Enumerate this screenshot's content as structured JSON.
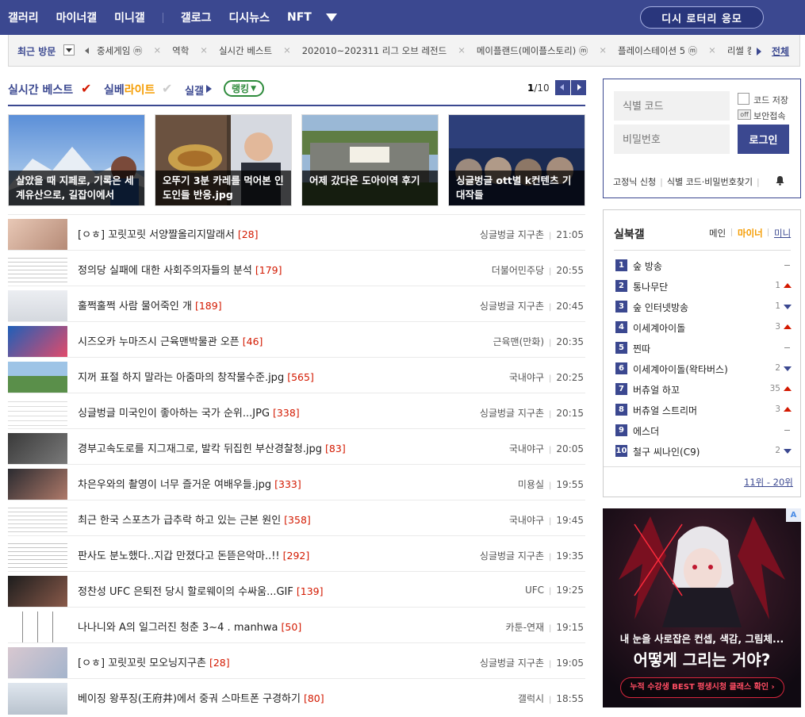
{
  "nav": {
    "items": [
      "갤러리",
      "마이너갤",
      "미니갤",
      "갤로그",
      "디시뉴스",
      "NFT"
    ],
    "lottery_button": "디시 로터리 응모"
  },
  "recent": {
    "label": "최근 방문",
    "items": [
      "중세게임 ⓜ",
      "역학",
      "실시간 베스트",
      "202010~202311 리그 오브 레전드",
      "메이플랜드(메이플스토리) ⓜ",
      "플레이스테이션 5 ⓜ",
      "리썰 컴퍼니"
    ],
    "all_label": "전체"
  },
  "best": {
    "tab_realtime": "실시간 베스트",
    "tab_light_a": "실베",
    "tab_light_b": "라이트",
    "tab_realgal": "실갤",
    "tab_ranking": "랭킹",
    "page_current": "1",
    "page_total": "/10"
  },
  "cards": [
    {
      "caption": "살았을 때 지페로, 기록은 세계유산으로, 길잡이에서"
    },
    {
      "caption": "오뚜기 3분 카레를 먹어본 인도인들 반응.jpg"
    },
    {
      "caption": "어제 갔다온 도아이역 후기"
    },
    {
      "caption": "싱글벙글 ott별 k컨텐츠 기대작들"
    }
  ],
  "posts": [
    {
      "title": "[ㅇㅎ] 꼬릿꼬릿 서양짤올리지말래서",
      "count": "[28]",
      "gallery": "싱글벙글 지구촌",
      "time": "21:05"
    },
    {
      "title": "정의당 실패에 대한 사회주의자들의 분석",
      "count": "[179]",
      "gallery": "더불어민주당",
      "time": "20:55"
    },
    {
      "title": "훌쩍훌쩍 사람 물어죽인 개",
      "count": "[189]",
      "gallery": "싱글벙글 지구촌",
      "time": "20:45"
    },
    {
      "title": "시즈오카 누마즈시 근육맨박물관 오픈",
      "count": "[46]",
      "gallery": "근육맨(만화)",
      "time": "20:35"
    },
    {
      "title": "지꺼 표절 하지 말라는 아줌마의 창작물수준.jpg",
      "count": "[565]",
      "gallery": "국내야구",
      "time": "20:25"
    },
    {
      "title": "싱글벙글 미국인이 좋아하는 국가 순위...JPG",
      "count": "[338]",
      "gallery": "싱글벙글 지구촌",
      "time": "20:15"
    },
    {
      "title": "경부고속도로를 지그재그로, 발칵 뒤집힌 부산경찰청.jpg",
      "count": "[83]",
      "gallery": "국내야구",
      "time": "20:05"
    },
    {
      "title": "차은우와의 촬영이 너무 즐거운 여배우들.jpg",
      "count": "[333]",
      "gallery": "미용실",
      "time": "19:55"
    },
    {
      "title": "최근 한국 스포츠가 급추락 하고 있는 근본 원인",
      "count": "[358]",
      "gallery": "국내야구",
      "time": "19:45"
    },
    {
      "title": "판사도 분노했다..지갑 만졌다고 돈뜯은악마..!!",
      "count": "[292]",
      "gallery": "싱글벙글 지구촌",
      "time": "19:35"
    },
    {
      "title": "정찬성 UFC 은퇴전 당시 할로웨이의 수싸움...GIF",
      "count": "[139]",
      "gallery": "UFC",
      "time": "19:25"
    },
    {
      "title": "나나니와 A의 일그러진 청춘 3~4 . manhwa",
      "count": "[50]",
      "gallery": "카툰-연재",
      "time": "19:15"
    },
    {
      "title": "[ㅇㅎ] 꼬릿꼬릿 모오닝지구촌",
      "count": "[28]",
      "gallery": "싱글벙글 지구촌",
      "time": "19:05"
    },
    {
      "title": "베이징 왕푸징(王府井)에서 중궈 스마트폰 구경하기",
      "count": "[80]",
      "gallery": "갤럭시",
      "time": "18:55"
    }
  ],
  "login": {
    "id_placeholder": "식별 코드",
    "pw_placeholder": "비밀번호",
    "save_code": "코드 저장",
    "secure_toggle": "off",
    "secure_label": "보안접속",
    "login_button": "로그인",
    "link_fixed": "고정닉 신청",
    "link_find": "식별 코드·비밀번호찾기"
  },
  "realtime": {
    "title": "실북갤",
    "tab_main": "메인",
    "tab_minor": "마이너",
    "tab_mini": "미니",
    "items": [
      {
        "rank": "1",
        "name": "숲 방송",
        "change": "",
        "dir": "same"
      },
      {
        "rank": "2",
        "name": "통나무단",
        "change": "1",
        "dir": "up"
      },
      {
        "rank": "3",
        "name": "숲 인터넷방송",
        "change": "1",
        "dir": "down"
      },
      {
        "rank": "4",
        "name": "이세계아이돌",
        "change": "3",
        "dir": "up"
      },
      {
        "rank": "5",
        "name": "찐따",
        "change": "",
        "dir": "same"
      },
      {
        "rank": "6",
        "name": "이세계아이돌(왁타버스)",
        "change": "2",
        "dir": "down"
      },
      {
        "rank": "7",
        "name": "버츄얼 하꼬",
        "change": "35",
        "dir": "up"
      },
      {
        "rank": "8",
        "name": "버츄얼 스트리머",
        "change": "3",
        "dir": "up"
      },
      {
        "rank": "9",
        "name": "에스더",
        "change": "",
        "dir": "same"
      },
      {
        "rank": "10",
        "name": "철구 씨나인(C9)",
        "change": "2",
        "dir": "down"
      }
    ],
    "more": "11위 - 20위"
  },
  "ad": {
    "tag": "A",
    "line1": "내 눈을 사로잡은 컨셉, 색감, 그림체...",
    "line2": "어떻게 그리는 거야?",
    "cta": "누적 수강생 BEST 평생시청 클래스 확인 ›"
  },
  "colors": {
    "brand": "#3b4890",
    "accent_red": "#d31900",
    "accent_orange": "#f59c00",
    "ranking_green": "#2e8b3c"
  }
}
